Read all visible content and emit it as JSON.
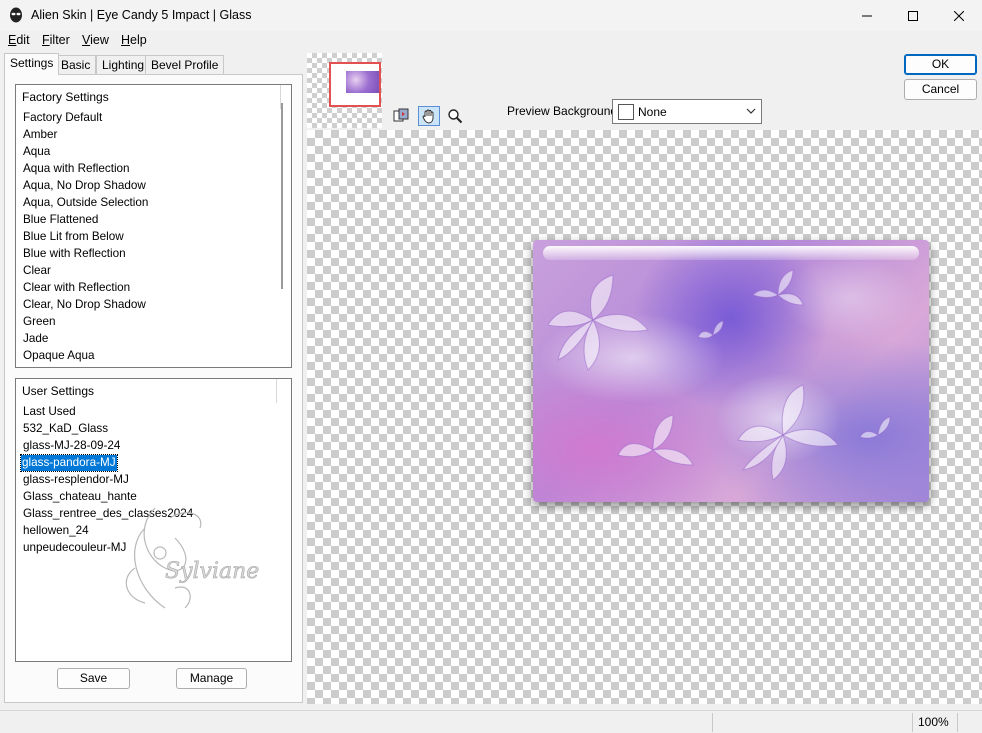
{
  "window": {
    "title": "Alien Skin | Eye Candy 5 Impact | Glass"
  },
  "menu": {
    "items": [
      {
        "first": "E",
        "rest": "dit"
      },
      {
        "first": "F",
        "rest": "ilter"
      },
      {
        "first": "V",
        "rest": "iew"
      },
      {
        "first": "H",
        "rest": "elp"
      }
    ]
  },
  "tabs": [
    "Settings",
    "Basic",
    "Lighting",
    "Bevel Profile"
  ],
  "factory": {
    "header": "Factory Settings",
    "items": [
      "Factory Default",
      "Amber",
      "Aqua",
      "Aqua with Reflection",
      "Aqua, No Drop Shadow",
      "Aqua, Outside Selection",
      "Blue Flattened",
      "Blue Lit from Below",
      "Blue with Reflection",
      "Clear",
      "Clear with Reflection",
      "Clear, No Drop Shadow",
      "Green",
      "Jade",
      "Opaque Aqua"
    ]
  },
  "user": {
    "header": "User Settings",
    "items": [
      "Last Used",
      "532_KaD_Glass",
      "glass-MJ-28-09-24",
      "glass-pandora-MJ",
      "glass-resplendor-MJ",
      "Glass_chateau_hante",
      "Glass_rentree_des_classes2024",
      "hellowen_24",
      "unpeudecouleur-MJ"
    ],
    "selected_index": 3
  },
  "buttons": {
    "save": "Save",
    "manage": "Manage",
    "ok": "OK",
    "cancel": "Cancel"
  },
  "preview_background": {
    "label": "Preview Background:",
    "value": "None"
  },
  "watermark": "Sylviane",
  "status": {
    "zoom": "100%"
  },
  "colors": {
    "selection": "#0078d7",
    "ok_border": "#0067c0",
    "navigator_frame": "#e25050"
  }
}
